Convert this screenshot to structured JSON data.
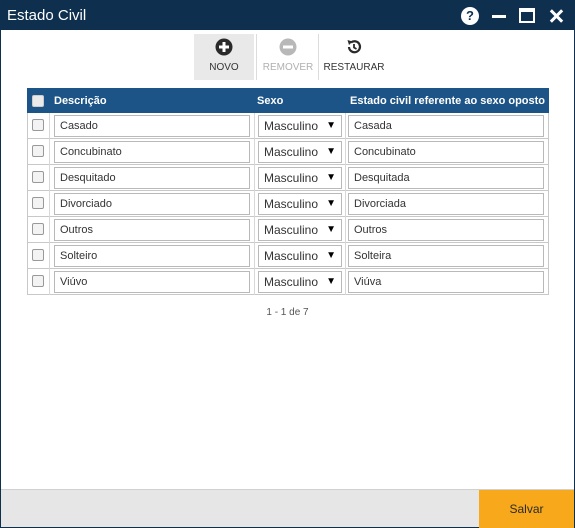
{
  "window": {
    "title": "Estado Civil"
  },
  "titlebar_icons": [
    "help-icon",
    "minimize-icon",
    "maximize-icon",
    "close-icon"
  ],
  "help_glyph": "?",
  "toolbar": {
    "novo_label": "NOVO",
    "remover_label": "REMOVER",
    "restaurar_label": "RESTAURAR"
  },
  "grid": {
    "headers": {
      "descricao": "Descrição",
      "sexo": "Sexo",
      "oposto": "Estado civil referente ao sexo oposto"
    },
    "rows": [
      {
        "descricao": "Casado",
        "sexo": "Masculino",
        "oposto": "Casada"
      },
      {
        "descricao": "Concubinato",
        "sexo": "Masculino",
        "oposto": "Concubinato"
      },
      {
        "descricao": "Desquitado",
        "sexo": "Masculino",
        "oposto": "Desquitada"
      },
      {
        "descricao": "Divorciado",
        "sexo": "Masculino",
        "oposto": "Divorciada"
      },
      {
        "descricao": "Outros",
        "sexo": "Masculino",
        "oposto": "Outros"
      },
      {
        "descricao": "Solteiro",
        "sexo": "Masculino",
        "oposto": "Solteira"
      },
      {
        "descricao": "Viúvo",
        "sexo": "Masculino",
        "oposto": "Viúva"
      }
    ]
  },
  "pager": {
    "text": "1 - 1 de 7"
  },
  "footer": {
    "save_label": "Salvar"
  },
  "colors": {
    "titlebar": "#0f2f4f",
    "grid_header": "#1c5487",
    "save_button": "#f7a81b"
  }
}
